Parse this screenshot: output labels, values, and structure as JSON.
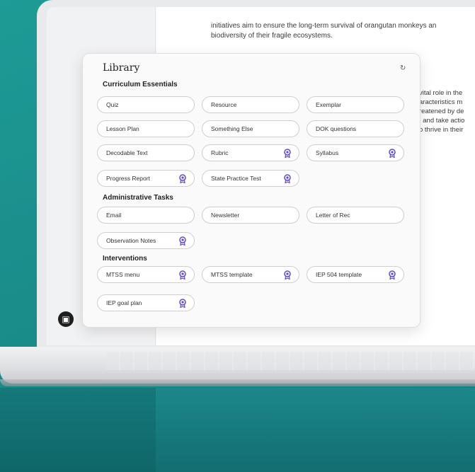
{
  "document": {
    "line1": "initiatives aim to ensure the long-term survival of orangutan monkeys an",
    "line2": "biodiversity of their fragile ecosystems.",
    "side_lines": [
      "vital role in the",
      "aracteristics m",
      "reatened by de",
      "; and take actio",
      "o thrive in their"
    ]
  },
  "library": {
    "title": "Library",
    "close_icon": "refresh-icon",
    "sections": {
      "curriculum": {
        "title": "Curriculum Essentials",
        "items": [
          "Quiz",
          "Resource",
          "Exemplar",
          "Lesson Plan",
          "Something Else",
          "DOK questions",
          "Decodable Text",
          "Rubric",
          "Syllabus",
          "Progress Report",
          "State Practice Test"
        ]
      },
      "admin": {
        "title": "Administrative Tasks",
        "items": [
          "Email",
          "Newsletter",
          "Letter of Rec",
          "Observation Notes"
        ]
      },
      "interventions": {
        "title": "Interventions",
        "items": [
          "MTSS menu",
          "MTSS template",
          "IEP 504 template",
          "IEP goal plan"
        ]
      }
    }
  },
  "colors": {
    "accent": "#5b4bd6",
    "background": "#1a8f8c"
  }
}
